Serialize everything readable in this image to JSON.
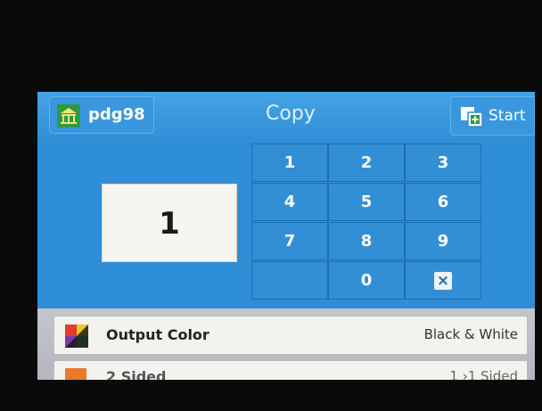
{
  "header": {
    "user_label": "pdg98",
    "title": "Copy",
    "start_label": "Start"
  },
  "quantity": {
    "value": "1"
  },
  "keypad": {
    "keys": [
      "1",
      "2",
      "3",
      "4",
      "5",
      "6",
      "7",
      "8",
      "9",
      "0"
    ],
    "clear_icon": "×"
  },
  "settings": [
    {
      "label": "Output Color",
      "value": "Black & White",
      "icon": "color-wheel-icon"
    },
    {
      "label": "2 Sided",
      "value": "1 ›1 Sided",
      "icon": "two-sided-icon"
    }
  ],
  "colors": {
    "screen_blue": "#2f8fd6",
    "key_blue": "#338fd5",
    "panel_gray": "#b3b7bd"
  }
}
